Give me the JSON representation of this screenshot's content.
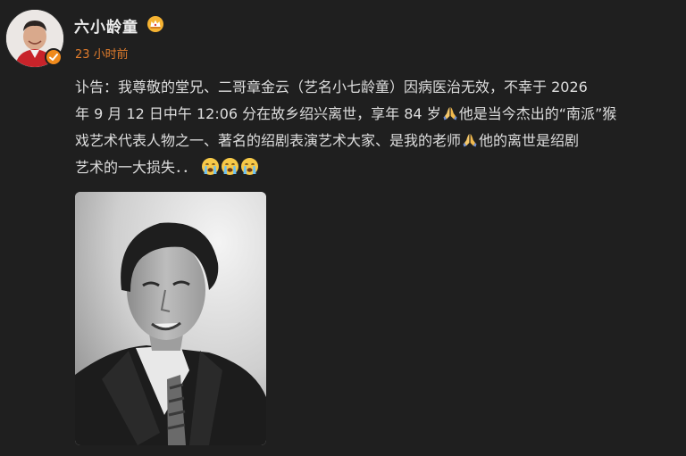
{
  "post": {
    "author_name": "六小龄童",
    "time": "23 小时前",
    "lines": [
      "讣告：我尊敬的堂兄、二哥章金云（艺名小七龄童）因病医治无效，不幸于 2026",
      "年 9 月 12 日中午 12:06 分在故乡绍兴离世，享年 84 岁",
      "他是当今杰出的“南派”猴",
      "戏艺术代表人物之一、著名的绍剧表演艺术大家、是我的老师",
      "他的离世是绍剧",
      "艺术的一大损失．．"
    ],
    "icons": {
      "vip": "crown-badge-icon",
      "verified": "verified-badge-icon",
      "pray": "praying-hands-emoji",
      "cry": "crying-face-emoji"
    }
  },
  "colors": {
    "background": "#1f1f1f",
    "text": "#dedede",
    "username": "#ededed",
    "time": "#e07c2c",
    "verified": "#f08a1c"
  }
}
